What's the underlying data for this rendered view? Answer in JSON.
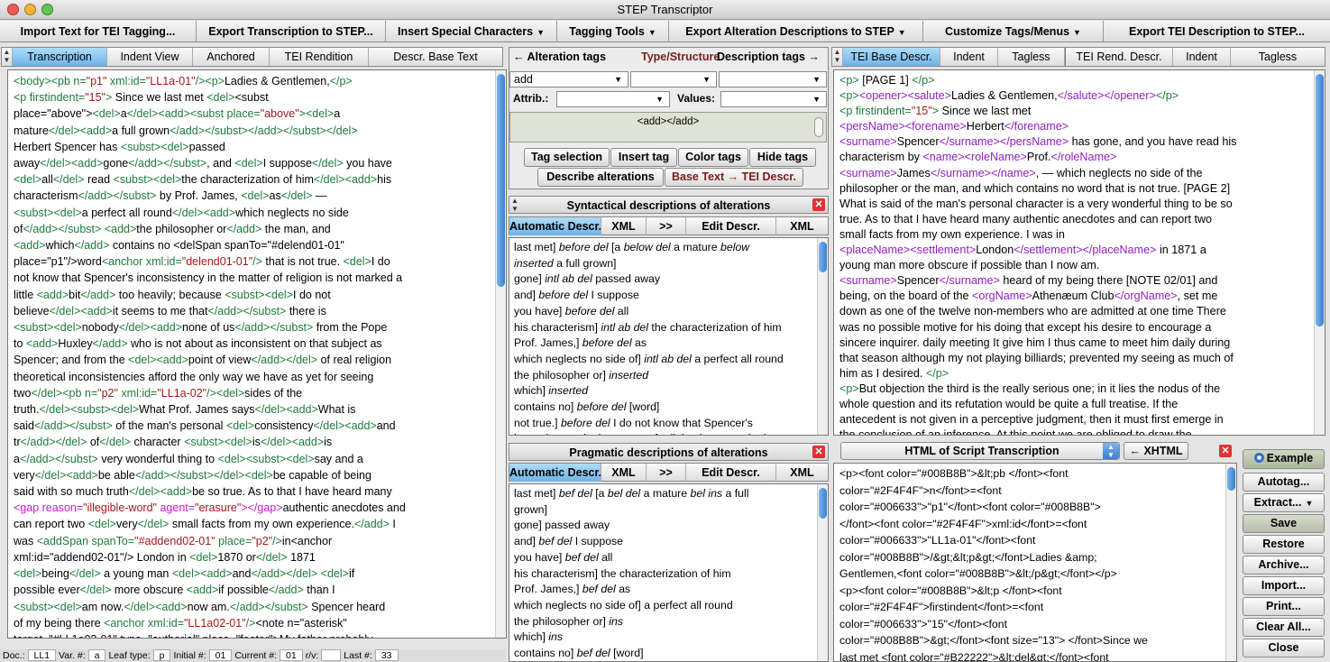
{
  "window": {
    "title": "STEP Transcriptor"
  },
  "menu": [
    {
      "label": "Import Text for TEI Tagging...",
      "dropdown": false
    },
    {
      "label": "Export Transcription to STEP...",
      "dropdown": false
    },
    {
      "label": "Insert Special Characters",
      "dropdown": true
    },
    {
      "label": "Tagging Tools",
      "dropdown": true
    },
    {
      "label": "Export Alteration Descriptions to STEP",
      "dropdown": true
    },
    {
      "label": "Customize Tags/Menus",
      "dropdown": true
    },
    {
      "label": "Export TEI Description to STEP...",
      "dropdown": false
    }
  ],
  "left_tabs": [
    "Transcription",
    "Indent View",
    "Anchored",
    "TEI Rendition",
    "Descr. Base Text"
  ],
  "transcription_lines": [
    "<body><pb n=\"p1\" xml:id=\"LL1a-01\"/><p>Ladies & Gentlemen,</p>",
    "<p firstindent=\"15\"> Since we last met <del><subst",
    "place=\"above\"><del>a</del><add><subst place=\"above\"><del>a",
    "mature</del><add>a full grown</add></subst></add></subst></del>",
    "Herbert Spencer has <subst><del>passed",
    "away</del><add>gone</add></subst>, and <del>I suppose</del> you have",
    "<del>all</del> read <subst><del>the characterization of him</del><add>his",
    "characterism</add></subst> by Prof. James, <del>as</del> —",
    "<subst><del>a perfect all round</del><add>which neglects no side",
    "of</add></subst> <add>the philosopher or</add> the man, and",
    "<add>which</add> contains no <delSpan spanTo=\"#delend01-01\"",
    "place=\"p1\"/>word<anchor xml:id=\"delend01-01\"/> that is not true. <del>I do",
    "not know that Spencer's inconsistency in the matter of religion is not marked a",
    "little <add>bit</add> too heavily; because <subst><del>I do not",
    "believe</del><add>it seems to me that</add></subst> there is",
    "<subst><del>nobody</del><add>none of us</add></subst> from the Pope",
    "to <add>Huxley</add> who is not about as inconsistent on that subject as",
    "Spencer; and from the <del><add>point of view</add></del> of real religion",
    "theoretical inconsistencies afford the only way we have as yet for seeing",
    "two</del><pb n=\"p2\" xml:id=\"LL1a-02\"/><del>sides of the",
    "truth.</del><subst><del>What Prof. James says</del><add>What is",
    "said</add></subst> of the man's personal <del>consistency</del><add>and",
    "tr</add></del> of</del> character <subst><del>is</del><add>is",
    "a</add></subst> very wonderful thing to <del><subst><del>say and a",
    "very</del><add>be able</add></subst></del><del>be capable of being",
    "said with so much truth</del><add>be so true. As to that I have heard many",
    "<gap reason=\"illegible-word\" agent=\"erasure\"></gap>authentic anecdotes and",
    "can report two <del>very</del> small facts from my own experience.</add> I",
    "was <addSpan spanTo=\"#addend02-01\" place=\"p2\"/>in<anchor",
    "xml:id=\"addend02-01\"/> London in <del>1870 or</del> 1871",
    "<del>being</del> a young man <del><add>and</add></del> <del>if",
    "possible ever</del> more obscure <add>if possible</add> than I",
    "<subst><del>am now.</del><add>now am.</add></subst> Spencer heard",
    "of my being there <anchor xml:id=\"LL1a02-01\"/><note n=\"asterisk\"",
    "target=\"#LL1a02-01\" type=\"authorial\" place=\"footer\">My father probably",
    "mentioned my visit in a letter to him.</note> and"
  ],
  "status": {
    "doc_label": "Doc.:",
    "doc_value": "LL1",
    "var_label": "Var. #:",
    "var_value": "a",
    "leaf_label": "Leaf type:",
    "leaf_value": "p",
    "initial_label": "Initial #:",
    "initial_value": "01",
    "current_label": "Current #:",
    "current_value": "01",
    "rv_label": "r/v:",
    "rv_value": "",
    "last_label": "Last #:",
    "last_value": "33"
  },
  "alteration": {
    "header_left": "← Alteration tags",
    "header_mid": "Type/Structure",
    "header_right": "Description tags →",
    "tag_select": "add",
    "attrib_label": "Attrib.:",
    "values_label": "Values:",
    "tag_preview": "<add></add>",
    "buttons": [
      "Tag selection",
      "Insert tag",
      "Color tags",
      "Hide tags"
    ],
    "describe_button": "Describe alterations",
    "base_button": "Base Text → TEI Descr."
  },
  "syntactical": {
    "title": "Syntactical descriptions of alterations",
    "tabs": [
      "Automatic Descr.",
      "XML",
      ">>",
      "Edit Descr.",
      "XML"
    ],
    "lines": [
      "last met] before del [a below del a mature below",
      "inserted a full grown]",
      "gone] intl ab del passed away",
      "and] before del I suppose",
      "you have] before del all",
      "his characterism] intl ab del the characterization of him",
      "Prof. James,] before del as",
      "which neglects no side of] intl ab del a perfect all round",
      "the philosopher or] inserted",
      "which] inserted",
      "contains no] before del [word]",
      "not true.] before del I do not know that Spencer's",
      "inconsistency in the matter of religion is not marked a"
    ]
  },
  "pragmatic": {
    "title": "Pragmatic descriptions of alterations",
    "tabs": [
      "Automatic Descr.",
      "XML",
      ">>",
      "Edit Descr.",
      "XML"
    ],
    "lines": [
      "last met] bef del [a bel del a mature bel ins a full",
      "grown]",
      "gone] passed away",
      "and] bef del I suppose",
      "you have] bef del all",
      "his characterism] the characterization of him",
      "Prof. James,] bef del as",
      "which neglects no side of] a perfect all round",
      "the philosopher or] ins",
      "which] ins",
      "contains no] bef del [word]",
      "not true.] bef del I do not know that Spencer's"
    ]
  },
  "tei_tabs": [
    "TEI Base Descr.",
    "Indent",
    "Tagless",
    "TEI Rend. Descr.",
    "Indent",
    "Tagless"
  ],
  "tei_lines": [
    "<p> [PAGE 1] </p>",
    "<p><opener><salute>Ladies & Gentlemen,</salute></opener></p>",
    "<p firstindent=\"15\"> Since we last met",
    "<persName><forename>Herbert</forename>",
    "<surname>Spencer</surname></persName> has gone, and you have read his",
    "characterism by <name><roleName>Prof.</roleName>",
    "<surname>James</surname></name>, — which neglects no side of the",
    "philosopher or the man, and which contains no word that is not true. [PAGE 2]",
    "What is said of the man's personal character is a very wonderful thing to be so",
    "true. As to that I have heard many authentic anecdotes and can report two",
    "small facts from my own experience. I was in",
    "<placeName><settlement>London</settlement></placeName> in 1871 a",
    "young man more obscure if possible than I now am.",
    "<surname>Spencer</surname> heard of my being there [NOTE 02/01] and",
    "being, on the board of the <orgName>Athenæum Club</orgName>, set me",
    "down as one of the twelve non-members who are admitted at one time There",
    "was no possible motive for his doing that except his desire to encourage a",
    "sincere inquirer. daily meeting It give him I thus came to meet him daily during",
    "that season although my not playing billiards; prevented my seeing as much of",
    "him as I desired. </p>",
    "<p>But objection the third is the really serious one; in it lies the nodus of the",
    "whole question and its refutation would be quite a full treatise. If the",
    "antecedent is not given in a perceptive judgment, then it must first emerge in",
    "the conclusion of an inference. At this point we are obliged to draw the"
  ],
  "html_panel": {
    "select": "HTML of Script Transcription",
    "xhtml_button": "← XHTML",
    "lines": [
      "<p><font color=\"#008B8B\">&lt;pb </font><font",
      "color=\"#2F4F4F\">n</font>=<font",
      "color=\"#006633\">\"p1\"</font><font color=\"#008B8B\">",
      "</font><font color=\"#2F4F4F\">xml:id</font>=<font",
      "color=\"#006633\">\"LL1a-01\"</font><font",
      "color=\"#008B8B\">/&gt;&lt;p&gt;</font>Ladies &amp;",
      "Gentlemen,<font color=\"#008B8B\">&lt;/p&gt;</font></p>",
      "<p><font color=\"#008B8B\">&lt;p </font><font",
      "color=\"#2F4F4F\">firstindent</font>=<font",
      "color=\"#006633\">\"15\"</font><font",
      "color=\"#008B8B\">&gt;</font><font size=\"13\"> </font>Since we",
      "last met <font color=\"#B22222\">&lt;del&gt;</font><font",
      "color=\"#0000FF\">&lt;subst </font><font"
    ]
  },
  "side_buttons": [
    "Example",
    "Autotag...",
    "Extract...",
    "Save",
    "Restore",
    "Archive...",
    "Import...",
    "Print...",
    "Clear All...",
    "Close"
  ],
  "colors": {
    "tag": "#1f7a3a",
    "tag_alt": "#8f1fbf",
    "attr_value": "#a01a1a",
    "gap": "#c71ccc",
    "selected_tab": "#6fb3e8"
  }
}
